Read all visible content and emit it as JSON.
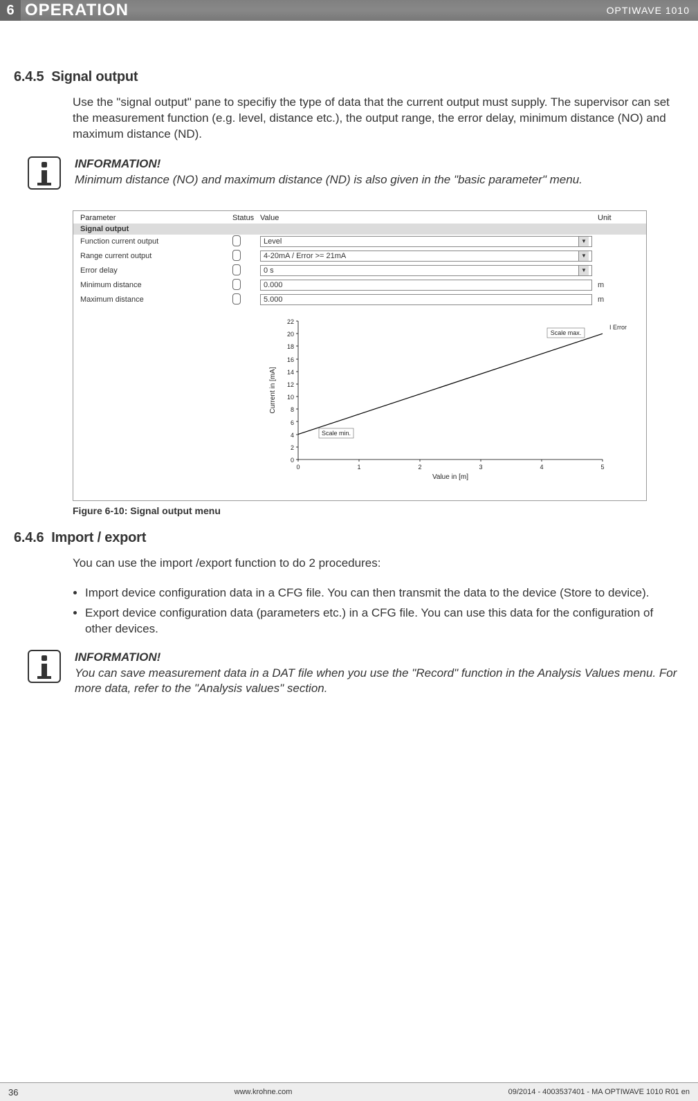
{
  "header": {
    "chapter_num": "6",
    "chapter_title": "OPERATION",
    "product": "OPTIWAVE 1010"
  },
  "sec1": {
    "num": "6.4.5",
    "title": "Signal output",
    "para": "Use the \"signal output\" pane to specifiy the type of data that the current output must supply. The supervisor can set the measurement function (e.g. level, distance etc.), the output range, the error delay, minimum distance (NO) and maximum distance (ND).",
    "info_title": "INFORMATION!",
    "info_body": "Minimum distance (NO) and maximum distance (ND) is also given in the \"basic parameter\" menu."
  },
  "screenshot": {
    "headers": {
      "param": "Parameter",
      "status": "Status",
      "value": "Value",
      "unit": "Unit"
    },
    "section_label": "Signal output",
    "rows": [
      {
        "param": "Function current output",
        "value": "Level",
        "type": "select",
        "unit": ""
      },
      {
        "param": "Range current output",
        "value": "4-20mA / Error >= 21mA",
        "type": "select",
        "unit": ""
      },
      {
        "param": "Error delay",
        "value": "0 s",
        "type": "select",
        "unit": ""
      },
      {
        "param": "Minimum distance",
        "value": "0.000",
        "type": "input",
        "unit": "m"
      },
      {
        "param": "Maximum distance",
        "value": "5.000",
        "type": "input",
        "unit": "m"
      }
    ]
  },
  "chart_data": {
    "type": "line",
    "title": "",
    "xlabel": "Value in [m]",
    "ylabel": "Current in [mA]",
    "xlim": [
      0,
      5
    ],
    "ylim": [
      0,
      22
    ],
    "xticks": [
      0,
      1,
      2,
      3,
      4,
      5
    ],
    "yticks": [
      0,
      2,
      4,
      6,
      8,
      10,
      12,
      14,
      16,
      18,
      20,
      22
    ],
    "series": [
      {
        "name": "output",
        "x": [
          0,
          5
        ],
        "y": [
          4,
          20
        ]
      }
    ],
    "annotations": [
      {
        "label": "Scale min.",
        "x": 0.5,
        "y": 4
      },
      {
        "label": "Scale max.",
        "x": 4.5,
        "y": 20
      },
      {
        "label": "I Error",
        "x": 5,
        "y": 21,
        "outside": true
      }
    ]
  },
  "fig_caption": "Figure 6-10: Signal output menu",
  "sec2": {
    "num": "6.4.6",
    "title": "Import / export",
    "para": "You can use the import /export function to do 2 procedures:",
    "bullets": [
      "Import device configuration data in a CFG file. You can then transmit the data to the device (Store to device).",
      "Export device configuration data (parameters etc.) in a CFG file. You can use this data for the configuration of other devices."
    ],
    "info_title": "INFORMATION!",
    "info_body": "You can save measurement data in a DAT file when you use the \"Record\" function in the Analysis Values menu. For more data, refer to the \"Analysis values\" section."
  },
  "footer": {
    "page": "36",
    "url": "www.krohne.com",
    "docref": "09/2014 - 4003537401 - MA OPTIWAVE 1010 R01 en"
  }
}
